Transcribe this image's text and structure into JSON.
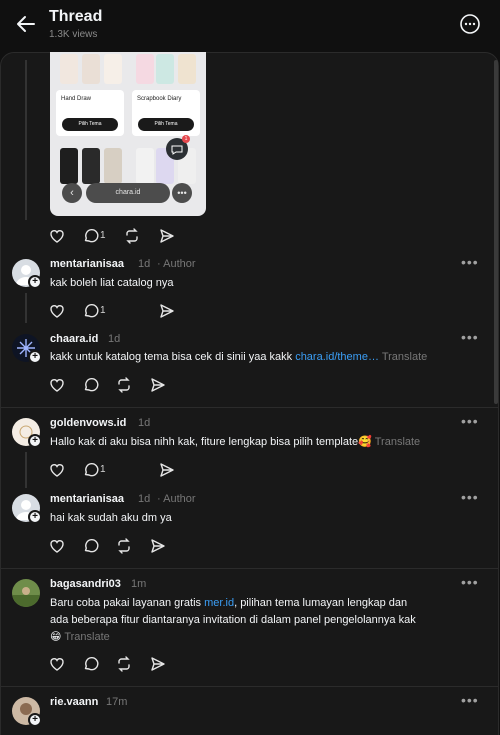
{
  "header": {
    "title": "Thread",
    "views": "1.3K views"
  },
  "media": {
    "cards": [
      {
        "title": "Hand Draw",
        "button": "Pilih Tema"
      },
      {
        "title": "Scrapbook Diary",
        "button": "Pilih Tema"
      }
    ],
    "url": "chara.id",
    "badge": "1"
  },
  "root_actions": {
    "reply_count": "1"
  },
  "comments": [
    {
      "username": "mentarianisaa",
      "time": "1d",
      "tag": "· Author",
      "text": "kak boleh liat catalog nya",
      "reply_count": "1"
    },
    {
      "username": "chaara.id",
      "time": "1d",
      "text_pre": "kakk untuk katalog tema bisa cek di sinii yaa kakk ",
      "link": "chara.id/theme…",
      "translate": "Translate",
      "reply_count": ""
    },
    {
      "username": "goldenvows.id",
      "time": "1d",
      "text": "Hallo kak di aku bisa nihh kak, fiture lengkap bisa pilih template🥰",
      "translate": "Translate",
      "reply_count": "1"
    },
    {
      "username": "mentarianisaa",
      "time": "1d",
      "tag": "· Author",
      "text": "hai kak sudah aku dm ya",
      "reply_count": ""
    },
    {
      "username": "bagasandri03",
      "time": "1m",
      "text_line1_pre": "Baru coba pakai layanan gratis ",
      "link": "mer.id",
      "text_line1_post": ", pilihan tema lumayan lengkap dan",
      "text_line2": "ada beberapa fitur diantaranya invitation di dalam panel pengelolannya kak",
      "text_line3": "😁",
      "translate": "Translate",
      "reply_count": ""
    },
    {
      "username": "rie.vaann",
      "time": "17m"
    }
  ]
}
